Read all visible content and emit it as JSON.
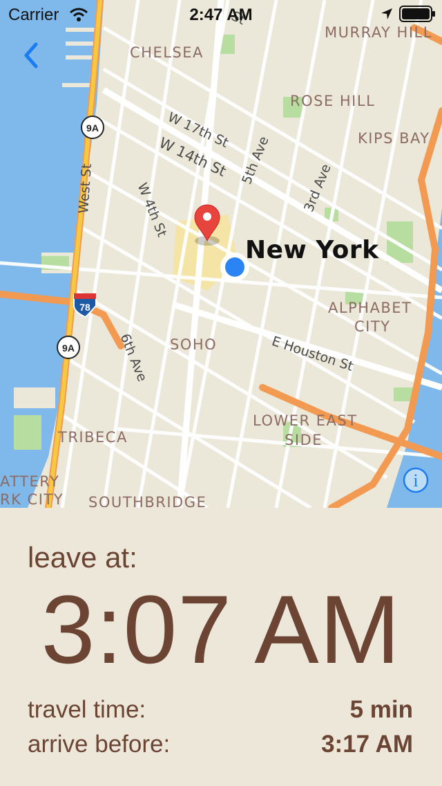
{
  "status_bar": {
    "carrier": "Carrier",
    "time": "2:47 AM"
  },
  "map": {
    "city_label": "New York",
    "neighborhoods": [
      "MURRAY HILL",
      "CHELSEA",
      "ROSE HILL",
      "KIPS BAY",
      "ALPHABET",
      "CITY",
      "SOHO",
      "LOWER EAST",
      "SIDE",
      "TRIBECA",
      "ATTERY",
      "RK CITY",
      "SOUTHBRIDGE"
    ],
    "streets": [
      "W 17th St",
      "W 14th St",
      "5th Ave",
      "3rd Ave",
      "W 4th St",
      "West St",
      "6th Ave",
      "E Houston St",
      "St"
    ],
    "shields": [
      "9A",
      "9A",
      "78"
    ],
    "colors": {
      "water": "#7fb8ea",
      "land": "#ece8d9",
      "highway": "#f29a52",
      "park": "#b7dea0",
      "pin": "#e8443e",
      "user_dot": "#2a84f4"
    }
  },
  "panel": {
    "leave_label": "leave at:",
    "leave_time": "3:07 AM",
    "travel_label": "travel time:",
    "travel_value": "5 min",
    "arrive_label": "arrive before:",
    "arrive_value": "3:17 AM"
  }
}
